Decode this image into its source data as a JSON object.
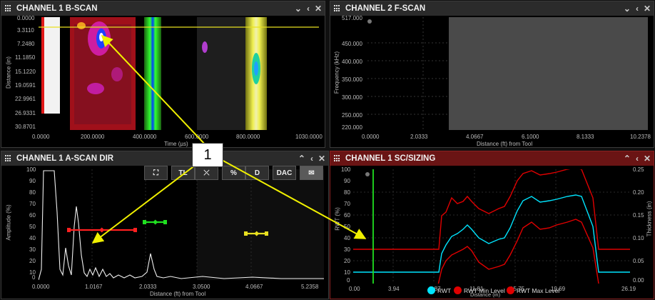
{
  "panels": {
    "bscan": {
      "title": "CHANNEL 1 B-SCAN",
      "y_ticks": [
        "0.0000",
        "3.3110",
        "7.2480",
        "11.1850",
        "15.1220",
        "19.0591",
        "22.9961",
        "26.9331",
        "30.8701"
      ],
      "x_ticks": [
        "0.0000",
        "200.0000",
        "400.0000",
        "600.0000",
        "800.0000",
        "1030.0000"
      ],
      "xlabel": "Time (µs)",
      "ylabel": "Distance (in)"
    },
    "fscan": {
      "title": "CHANNEL 2 F-SCAN",
      "y_ticks": [
        "517.000",
        "450.000",
        "400.000",
        "350.000",
        "300.000",
        "250.000",
        "220.000"
      ],
      "x_ticks": [
        "0.0000",
        "2.0333",
        "4.0667",
        "6.1000",
        "8.1333",
        "10.2378"
      ],
      "xlabel": "Distance (ft) from Tool",
      "ylabel": "Frequency (kHz)"
    },
    "ascan": {
      "title": "CHANNEL 1 A-SCAN DIR",
      "y_ticks": [
        "100",
        "90",
        "80",
        "70",
        "60",
        "50",
        "40",
        "30",
        "20",
        "10",
        "0"
      ],
      "x_ticks": [
        "0.0000",
        "1.0167",
        "2.0333",
        "3.0500",
        "4.0667",
        "5.2358"
      ],
      "xlabel": "Distance (ft) from Tool",
      "ylabel": "Amplitude (%)",
      "toolbar": [
        "TL",
        "%",
        "D",
        "DAC"
      ]
    },
    "sizing": {
      "title": "CHANNEL 1 SC/SIZING",
      "y_left_ticks": [
        "100",
        "90",
        "80",
        "70",
        "60",
        "50",
        "40",
        "30",
        "20",
        "10",
        "0"
      ],
      "y_right_ticks": [
        "0.25",
        "0.20",
        "0.15",
        "0.10",
        "0.05",
        "0.00"
      ],
      "x_ticks": [
        "0.00",
        "3.94",
        "7.87",
        "11.81",
        "15.75",
        "19.69",
        "26.19"
      ],
      "xlabel": "Distance (in)",
      "ylabel_left": "RWT (%)",
      "ylabel_right": "Thickness (in)",
      "legend": [
        {
          "label": "RWT",
          "color": "#00e5ff"
        },
        {
          "label": "RWT Min Level",
          "color": "#e00000"
        },
        {
          "label": "RWT Max Level",
          "color": "#e00000"
        }
      ]
    }
  },
  "callout": {
    "label": "1"
  },
  "colors": {
    "accent_active": "#6a1414",
    "gate_red": "#ff2020",
    "gate_green": "#20e020",
    "gate_yellow": "#e8e020",
    "rwt": "#00e5ff",
    "arrow": "#f0f000"
  }
}
